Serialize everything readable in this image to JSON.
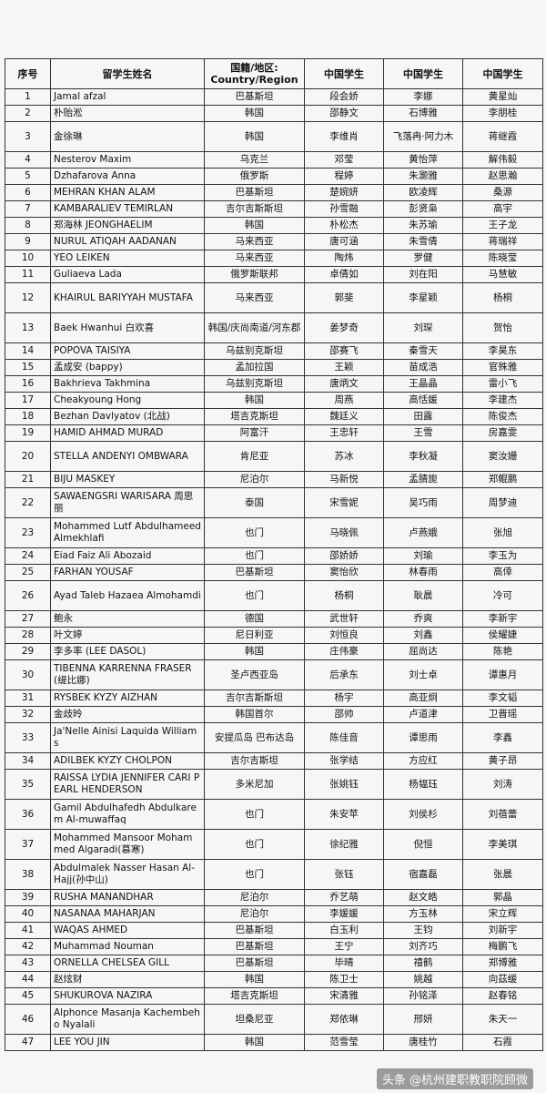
{
  "headers": [
    "序号",
    "留学生姓名",
    "国籍/地区: Country/Region",
    "中国学生",
    "中国学生",
    "中国学生"
  ],
  "rows": [
    {
      "n": "1",
      "name": "Jamal afzal",
      "country": "巴基斯坦",
      "s1": "段会娇",
      "s2": "李娜",
      "s3": "黄星灿"
    },
    {
      "n": "2",
      "name": "朴贻淞",
      "country": "韩国",
      "s1": "邵静文",
      "s2": "石博雅",
      "s3": "李朋桂"
    },
    {
      "n": "3",
      "name": "金徐琳",
      "country": "韩国",
      "s1": "李维肖",
      "s2": "飞落冉·阿力木",
      "s3": "蒋继霞"
    },
    {
      "n": "4",
      "name": "Nesterov Maxim",
      "country": "乌克兰",
      "s1": "邓莹",
      "s2": "黄怡萍",
      "s3": "解伟毅"
    },
    {
      "n": "5",
      "name": "Dzhafarova Anna",
      "country": "俄罗斯",
      "s1": "程婷",
      "s2": "朱灏雅",
      "s3": "赵思瀚"
    },
    {
      "n": "6",
      "name": "MEHRAN KHAN ALAM",
      "country": "巴基斯坦",
      "s1": "楚婉妍",
      "s2": "欧凌辉",
      "s3": "桑源"
    },
    {
      "n": "7",
      "name": "KAMBARALIEV TEMIRLAN",
      "country": "吉尔吉斯斯坦",
      "s1": "孙雪融",
      "s2": "彭贤枭",
      "s3": "高宇"
    },
    {
      "n": "8",
      "name": "郑海林 JEONGHAELIM",
      "country": "韩国",
      "s1": "朴松杰",
      "s2": "朱苏瑜",
      "s3": "王子龙"
    },
    {
      "n": "9",
      "name": "NURUL ATIQAH AADANAN",
      "country": "马来西亚",
      "s1": "唐可涵",
      "s2": "朱雪倩",
      "s3": "蒋瑞祥"
    },
    {
      "n": "10",
      "name": "YEO LEIKEN",
      "country": "马来西亚",
      "s1": "陶炜",
      "s2": "罗健",
      "s3": "陈晓莹"
    },
    {
      "n": "11",
      "name": "Guliaeva Lada",
      "country": "俄罗斯联邦",
      "s1": "卓倩如",
      "s2": "刘在阳",
      "s3": "马慧敏"
    },
    {
      "n": "12",
      "name": "KHAIRUL BARIYYAH MUSTAFA",
      "country": "马来西亚",
      "s1": "郭斐",
      "s2": "李星颖",
      "s3": "杨桐"
    },
    {
      "n": "13",
      "name": "Baek Hwanhui 白欢喜",
      "country": "韩国/庆尚南道/河东郡",
      "s1": "姜梦奇",
      "s2": "刘琛",
      "s3": "贺怡"
    },
    {
      "n": "14",
      "name": "POPOVA TAISIYA",
      "country": "乌兹别克斯坦",
      "s1": "邵赛飞",
      "s2": "秦雪天",
      "s3": "李昊东"
    },
    {
      "n": "15",
      "name": "孟成安 (bappy)",
      "country": "孟加拉国",
      "s1": "王颖",
      "s2": "苗成浩",
      "s3": "官殊雅"
    },
    {
      "n": "16",
      "name": "Bakhrieva Takhmina",
      "country": "乌兹别克斯坦",
      "s1": "唐炳文",
      "s2": "王晶晶",
      "s3": "雷小飞"
    },
    {
      "n": "17",
      "name": "Cheakyoung Hong",
      "country": "韩国",
      "s1": "周燕",
      "s2": "高恬媛",
      "s3": "李建杰"
    },
    {
      "n": "18",
      "name": "Bezhan Davlyatov (北战)",
      "country": "塔吉克斯坦",
      "s1": "魏廷义",
      "s2": "田露",
      "s3": "陈俊杰"
    },
    {
      "n": "19",
      "name": "HAMID AHMAD MURAD",
      "country": "阿富汗",
      "s1": "王忠轩",
      "s2": "王雪",
      "s3": "房嘉雯"
    },
    {
      "n": "20",
      "name": "STELLA ANDENYI OMBWARA",
      "country": "肯尼亚",
      "s1": "苏冰",
      "s2": "李秋凝",
      "s3": "窦汝姗"
    },
    {
      "n": "21",
      "name": "BIJU MASKEY",
      "country": "尼泊尔",
      "s1": "马新悦",
      "s2": "孟腈旎",
      "s3": "郑鲲鹏"
    },
    {
      "n": "22",
      "name": "SAWAENGSRI WARISARA 周思丽",
      "country": "泰国",
      "s1": "宋雪妮",
      "s2": "吴巧雨",
      "s3": "周梦迪"
    },
    {
      "n": "23",
      "name": "Mohammed Lutf Abdulhameed Almekhlafi",
      "country": "也门",
      "s1": "马晓佩",
      "s2": "卢燕娥",
      "s3": "张旭"
    },
    {
      "n": "24",
      "name": "Eiad Faiz Ali Abozaid",
      "country": "也门",
      "s1": "邵娇娇",
      "s2": "刘瑜",
      "s3": "李玉为"
    },
    {
      "n": "25",
      "name": "FARHAN YOUSAF",
      "country": "巴基斯坦",
      "s1": "窦怡欣",
      "s2": "林春雨",
      "s3": "高倖"
    },
    {
      "n": "26",
      "name": "Ayad Taleb Hazaea Almohamdi",
      "country": "也门",
      "s1": "杨桐",
      "s2": "耿晨",
      "s3": "冷可"
    },
    {
      "n": "27",
      "name": "鲍永",
      "country": "德国",
      "s1": "武世轩",
      "s2": "乔爽",
      "s3": "李新宇"
    },
    {
      "n": "28",
      "name": "叶文婷",
      "country": "尼日利亚",
      "s1": "刘恒良",
      "s2": "刘鑫",
      "s3": "侯耀婕"
    },
    {
      "n": "29",
      "name": "李多率 (LEE DASOL)",
      "country": "韩国",
      "s1": "庄伟豪",
      "s2": "屈尚达",
      "s3": "陈艳"
    },
    {
      "n": "30",
      "name": "TIBENNA KARRENNA FRASER (缇比娜)",
      "country": "圣卢西亚岛",
      "s1": "后承东",
      "s2": "刘士卓",
      "s3": "谭惠月"
    },
    {
      "n": "31",
      "name": "RYSBEK KYZY AIZHAN",
      "country": "吉尔吉斯斯坦",
      "s1": "杨宇",
      "s2": "高亚炯",
      "s3": "李文韬"
    },
    {
      "n": "32",
      "name": "金歧昤",
      "country": "韩国首尔",
      "s1": "邵帅",
      "s2": "卢道津",
      "s3": "卫晋瑶"
    },
    {
      "n": "33",
      "name": "Ja'Nelle Ainisi Laquida Williams",
      "country": "安提瓜岛 巴布达岛",
      "s1": "陈佳音",
      "s2": "谭思雨",
      "s3": "李鑫"
    },
    {
      "n": "34",
      "name": "ADILBEK KYZY CHOLPON",
      "country": "吉尔吉斯坦",
      "s1": "张学结",
      "s2": "方应红",
      "s3": "黄子昂"
    },
    {
      "n": "35",
      "name": "RAISSA LYDIA JENNIFER CARI PEARL HENDERSON",
      "country": "多米尼加",
      "s1": "张姚钰",
      "s2": "杨韫珏",
      "s3": "刘涛"
    },
    {
      "n": "36",
      "name": "Gamil Abdulhafedh Abdulkarem Al-muwaffaq",
      "country": "也门",
      "s1": "朱安苹",
      "s2": "刘侯杉",
      "s3": "刘蓓蕾"
    },
    {
      "n": "37",
      "name": "Mohammed Mansoor Mohammed Algaradi(慕寒)",
      "country": "也门",
      "s1": "徐纪雅",
      "s2": "倪恒",
      "s3": "李美琪"
    },
    {
      "n": "38",
      "name": "Abdulmalek Nasser Hasan Al-Hajj(孙中山)",
      "country": "也门",
      "s1": "张钰",
      "s2": "宿嘉磊",
      "s3": "张晨"
    },
    {
      "n": "39",
      "name": "RUSHA MANANDHAR",
      "country": "尼泊尔",
      "s1": "乔艺萌",
      "s2": "赵文皓",
      "s3": "郭晶"
    },
    {
      "n": "40",
      "name": "NASANAA MAHARJAN",
      "country": "尼泊尔",
      "s1": "李媛媛",
      "s2": "方玉林",
      "s3": "宋立辉"
    },
    {
      "n": "41",
      "name": "WAQAS AHMED",
      "country": "巴基斯坦",
      "s1": "白玉利",
      "s2": "王钧",
      "s3": "刘新宇"
    },
    {
      "n": "42",
      "name": "Muhammad Nouman",
      "country": "巴基斯坦",
      "s1": "王宁",
      "s2": "刘齐巧",
      "s3": "梅鹏飞"
    },
    {
      "n": "43",
      "name": "ORNELLA CHELSEA GILL",
      "country": "巴基斯坦",
      "s1": "毕晴",
      "s2": "禧鹤",
      "s3": "郑博雅"
    },
    {
      "n": "44",
      "name": "赵炫财",
      "country": "韩国",
      "s1": "陈卫士",
      "s2": "姚越",
      "s3": "向茲缓"
    },
    {
      "n": "45",
      "name": "SHUKUROVA NAZIRA",
      "country": "塔吉克斯坦",
      "s1": "宋清雅",
      "s2": "孙铭泽",
      "s3": "赵春铭"
    },
    {
      "n": "46",
      "name": "Alphonce Masanja Kachembeho Nyalali",
      "country": "坦桑尼亚",
      "s1": "郑依琳",
      "s2": "邢妍",
      "s3": "朱天一"
    },
    {
      "n": "47",
      "name": "LEE YOU JIN",
      "country": "韩国",
      "s1": "范雪莹",
      "s2": "唐桂竹",
      "s3": "石霞"
    }
  ],
  "watermark": "头条 @杭州建职教职院顾微"
}
